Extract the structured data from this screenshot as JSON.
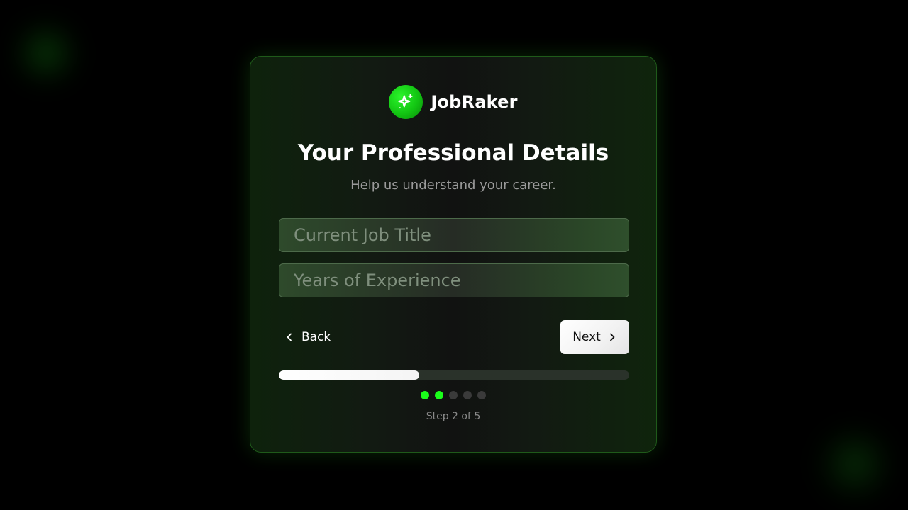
{
  "brand": {
    "name": "JobRaker",
    "logo_icon": "sparkles-icon",
    "accent": "#1aff1a"
  },
  "header": {
    "title": "Your Professional Details",
    "subtitle": "Help us understand your career."
  },
  "form": {
    "job_title": {
      "value": "",
      "placeholder": "Current Job Title"
    },
    "experience": {
      "value": "",
      "placeholder": "Years of Experience"
    }
  },
  "nav": {
    "back_label": "Back",
    "back_icon": "chevron-left-icon",
    "next_label": "Next",
    "next_icon": "chevron-right-icon"
  },
  "progress": {
    "current_step": 2,
    "total_steps": 5,
    "fraction": 0.4,
    "label": "Step 2 of 5"
  }
}
